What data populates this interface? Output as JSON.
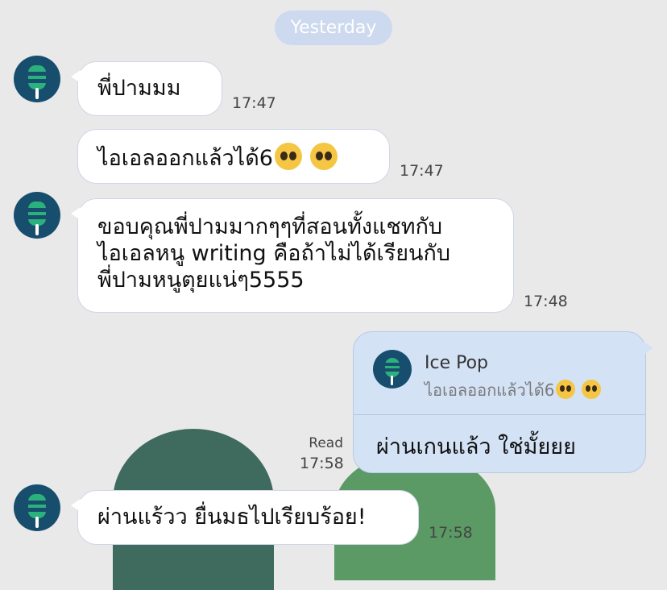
{
  "date_label": "Yesterday",
  "messages": [
    {
      "text": "พี่ปามมม",
      "time": "17:47"
    },
    {
      "text": "ไอเอลออกแล้วได้6",
      "emoji": "pleading-face-emoji",
      "time": "17:47"
    },
    {
      "text": "ขอบคุณพี่ปามมากๆๆที่สอนทั้งแชทกับ\nไอเอลหนู writing คือถ้าไม่ได้เรียนกับ\nพี่ปามหนูตุยแน่ๆ5555",
      "time": "17:48"
    },
    {
      "text": "ผ่านแร้วว ยื่นมธไปเรียบร้อย!",
      "time": "17:58"
    }
  ],
  "reply": {
    "quoted_name": "Ice Pop",
    "quoted_text": "ไอเอลออกแล้วได้6",
    "text": "ผ่านเกนแล้ว ใช่มั้ยยย",
    "read_label": "Read",
    "time": "17:58"
  },
  "colors": {
    "background": "#e9e9ea",
    "outgoing_bubble": "#d4e2f6",
    "avatar": "#184e6d",
    "popsicle": "#2bb27c"
  }
}
